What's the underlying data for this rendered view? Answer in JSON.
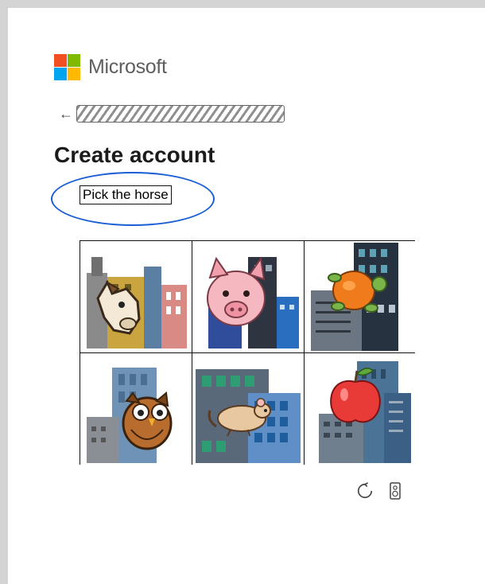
{
  "brand": {
    "name": "Microsoft",
    "logo_colors": [
      "#F25022",
      "#7FBA00",
      "#00A4EF",
      "#FFB900"
    ]
  },
  "back": {
    "icon": "back-arrow-icon",
    "redacted_field": "redacted-email"
  },
  "heading": {
    "title": "Create account"
  },
  "challenge": {
    "prompt": "Pick the horse",
    "highlight_color": "#1A5ED6",
    "tiles": [
      {
        "animal": "horse",
        "row": 1,
        "col": 1
      },
      {
        "animal": "pig",
        "row": 1,
        "col": 2
      },
      {
        "animal": "turtle",
        "row": 1,
        "col": 3
      },
      {
        "animal": "owl",
        "row": 2,
        "col": 1
      },
      {
        "animal": "rat",
        "row": 2,
        "col": 2
      },
      {
        "animal": "apple",
        "row": 2,
        "col": 3
      }
    ]
  },
  "controls": {
    "refresh_icon": "refresh-icon",
    "audio_icon": "speaker-icon"
  }
}
